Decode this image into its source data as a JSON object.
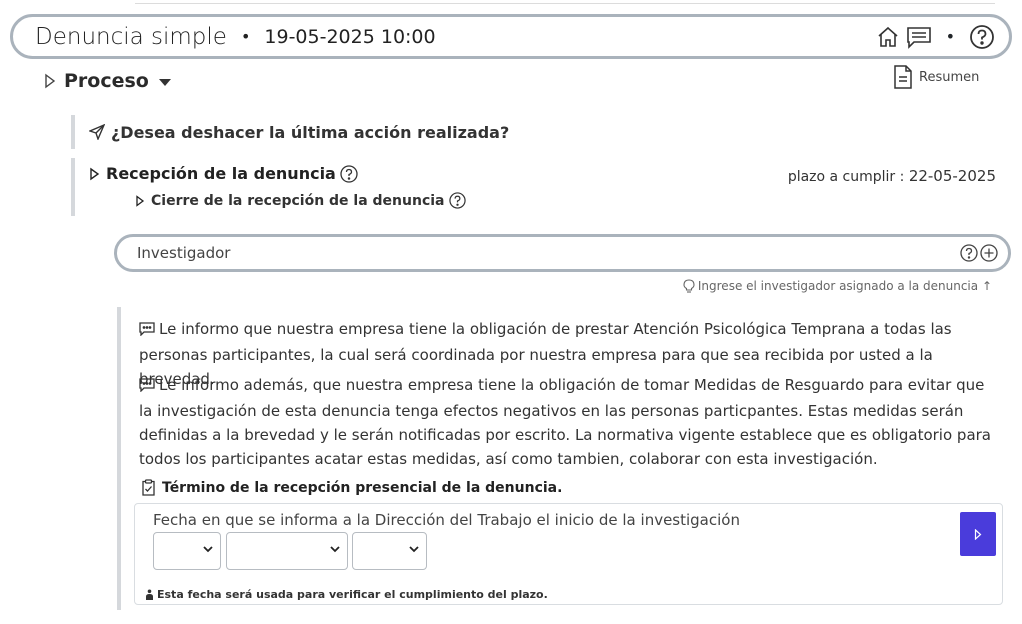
{
  "header": {
    "title": "Denuncia simple",
    "separator": "•",
    "date": "19-05-2025 10:00",
    "dot": "•"
  },
  "proceso": {
    "label": "Proceso"
  },
  "resumen": {
    "label": "Resumen"
  },
  "undo": {
    "question": "¿Desea deshacer la última acción realizada?"
  },
  "recepcion": {
    "title": "Recepción de la denuncia",
    "plazo_label": "plazo a cumplir :",
    "plazo_value": "22-05-2025",
    "cierre": "Cierre de la recepción de la denuncia"
  },
  "investigador": {
    "placeholder": "Investigador",
    "hint": "Ingrese el investigador asignado a la denuncia ↑"
  },
  "messages": {
    "p1": "Le informo que nuestra empresa tiene la obligación de prestar Atención Psicológica Temprana a todas las personas participantes, la cual será coordinada por nuestra empresa para que sea recibida por usted a la brevedad.",
    "p2": "Le informo además, que nuestra empresa tiene la obligación de tomar Medidas de Resguardo para evitar que la investigación de esta denuncia tenga efectos negativos en las personas particpantes. Estas medidas serán definidas a la brevedad y le serán notificadas por escrito. La normativa vigente establece que es obligatorio para todos los participantes acatar estas medidas, así como tambien, colaborar con esta investigación."
  },
  "termino": {
    "title": "Término de la recepción presencial de la denuncia."
  },
  "fecha": {
    "label": "Fecha en que se informa a la Dirección del Trabajo el inicio de la investigación",
    "note": "Esta fecha será usada para verificar el cumplimiento del plazo.",
    "day": "",
    "month": "",
    "year": ""
  },
  "colors": {
    "accent": "#4a3cdb",
    "border": "#aab3bc",
    "rail": "#d5d8dc"
  },
  "icons": [
    "home-icon",
    "chat-icon",
    "help-icon",
    "document-icon",
    "triangle-right-icon",
    "caret-down-icon",
    "send-icon",
    "lightbulb-icon",
    "clipboard-check-icon",
    "plus-circle-icon",
    "person-icon"
  ]
}
